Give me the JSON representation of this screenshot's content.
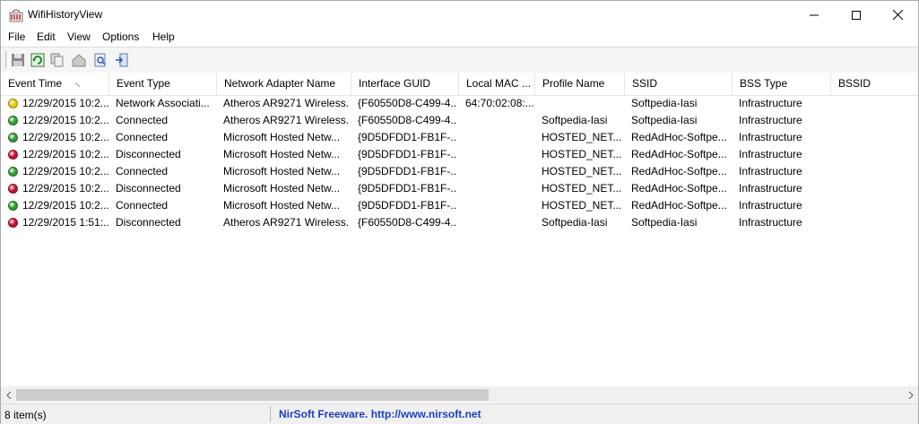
{
  "window": {
    "title": "WifiHistoryView",
    "icon": "wifi-history-app-icon"
  },
  "menu": [
    "File",
    "Edit",
    "View",
    "Options",
    "Help"
  ],
  "toolbar": {
    "buttons": [
      "save-icon",
      "refresh-icon",
      "copy-icon",
      "properties-icon",
      "find-icon",
      "exit-icon"
    ]
  },
  "columns": [
    "Event Time",
    "Event Type",
    "Network Adapter Name",
    "Interface GUID",
    "Local MAC ...",
    "Profile Name",
    "SSID",
    "BSS Type",
    "BSSID"
  ],
  "status_colors": {
    "yellow": "#f0c800",
    "green": "#2ca02c",
    "red": "#c8102e"
  },
  "rows": [
    {
      "status": "yellow",
      "cells": [
        "12/29/2015 10:2...",
        "Network Associati...",
        "Atheros AR9271 Wireless...",
        "{F60550D8-C499-4...",
        "64:70:02:08:...",
        "",
        "Softpedia-Iasi",
        "Infrastructure",
        ""
      ]
    },
    {
      "status": "green",
      "cells": [
        "12/29/2015 10:2...",
        "Connected",
        "Atheros AR9271 Wireless...",
        "{F60550D8-C499-4...",
        "",
        "Softpedia-Iasi",
        "Softpedia-Iasi",
        "Infrastructure",
        ""
      ]
    },
    {
      "status": "green",
      "cells": [
        "12/29/2015 10:2...",
        "Connected",
        "Microsoft Hosted Netw...",
        "{9D5DFDD1-FB1F-...",
        "",
        "HOSTED_NET...",
        "RedAdHoc-Softpe...",
        "Infrastructure",
        ""
      ]
    },
    {
      "status": "red",
      "cells": [
        "12/29/2015 10:2...",
        "Disconnected",
        "Microsoft Hosted Netw...",
        "{9D5DFDD1-FB1F-...",
        "",
        "HOSTED_NET...",
        "RedAdHoc-Softpe...",
        "Infrastructure",
        ""
      ]
    },
    {
      "status": "green",
      "cells": [
        "12/29/2015 10:2...",
        "Connected",
        "Microsoft Hosted Netw...",
        "{9D5DFDD1-FB1F-...",
        "",
        "HOSTED_NET...",
        "RedAdHoc-Softpe...",
        "Infrastructure",
        ""
      ]
    },
    {
      "status": "red",
      "cells": [
        "12/29/2015 10:2...",
        "Disconnected",
        "Microsoft Hosted Netw...",
        "{9D5DFDD1-FB1F-...",
        "",
        "HOSTED_NET...",
        "RedAdHoc-Softpe...",
        "Infrastructure",
        ""
      ]
    },
    {
      "status": "green",
      "cells": [
        "12/29/2015 10:2...",
        "Connected",
        "Microsoft Hosted Netw...",
        "{9D5DFDD1-FB1F-...",
        "",
        "HOSTED_NET...",
        "RedAdHoc-Softpe...",
        "Infrastructure",
        ""
      ]
    },
    {
      "status": "red",
      "cells": [
        "12/29/2015 1:51:...",
        "Disconnected",
        "Atheros AR9271 Wireless...",
        "{F60550D8-C499-4...",
        "",
        "Softpedia-Iasi",
        "Softpedia-Iasi",
        "Infrastructure",
        ""
      ]
    }
  ],
  "status_bar": {
    "item_count": "8 item(s)",
    "credit": "NirSoft Freeware.  http://www.nirsoft.net"
  }
}
